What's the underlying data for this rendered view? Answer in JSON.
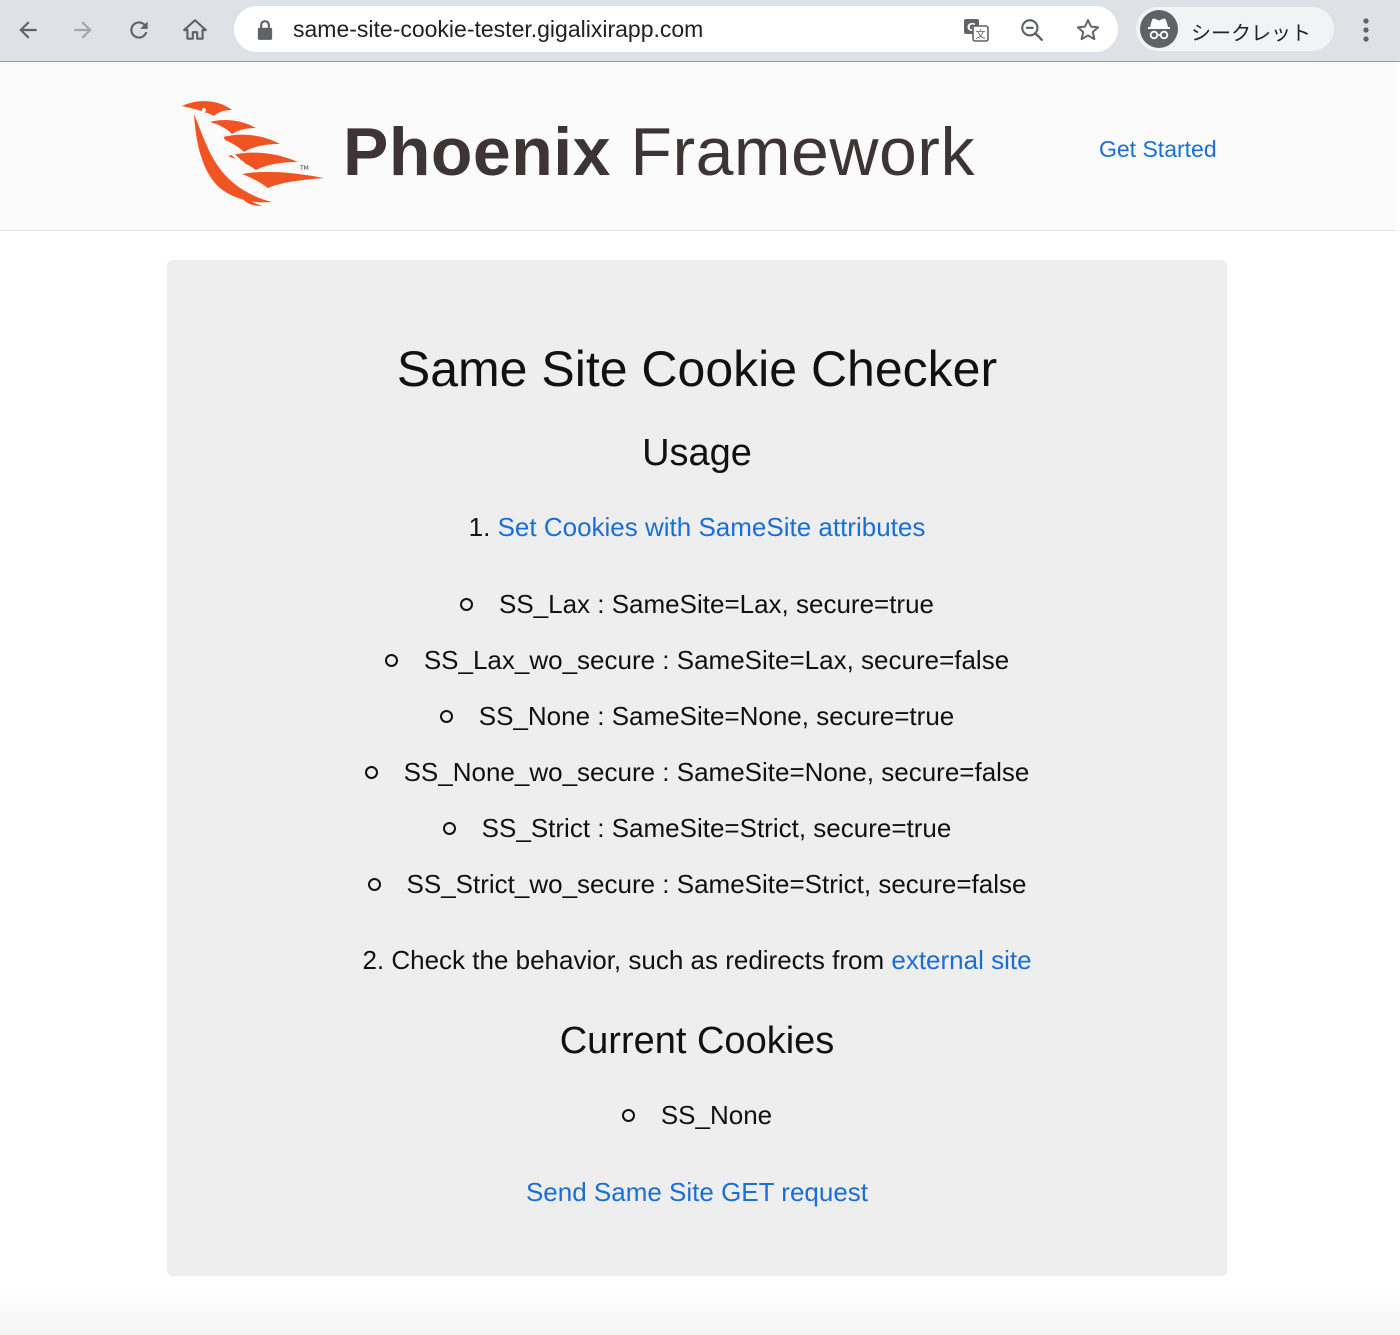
{
  "browser": {
    "url": "same-site-cookie-tester.gigalixirapp.com",
    "incognito_label": "シークレット"
  },
  "header": {
    "logo_bold": "Phoenix",
    "logo_regular": "Framework",
    "nav_link": "Get Started",
    "brand_color": "#f05423"
  },
  "main": {
    "title": "Same Site Cookie Checker",
    "usage_heading": "Usage",
    "step1_number": "1.",
    "step1_link": "Set Cookies with SameSite attributes",
    "cookie_options": [
      "SS_Lax : SameSite=Lax, secure=true",
      "SS_Lax_wo_secure : SameSite=Lax, secure=false",
      "SS_None : SameSite=None, secure=true",
      "SS_None_wo_secure : SameSite=None, secure=false",
      "SS_Strict : SameSite=Strict, secure=true",
      "SS_Strict_wo_secure : SameSite=Strict, secure=false"
    ],
    "step2_text": "2. Check the behavior, such as redirects from",
    "step2_link": "external site",
    "current_cookies_heading": "Current Cookies",
    "current_cookies": [
      "SS_None"
    ],
    "send_request_link": "Send Same Site GET request"
  }
}
